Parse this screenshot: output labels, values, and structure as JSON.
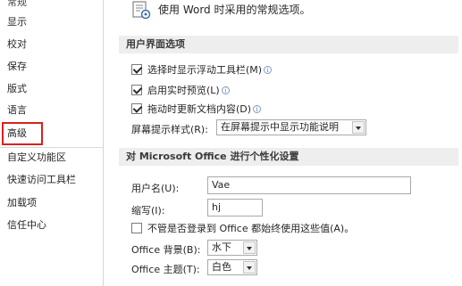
{
  "sidebar": {
    "items": [
      {
        "label": "常规"
      },
      {
        "label": "显示"
      },
      {
        "label": "校对"
      },
      {
        "label": "保存"
      },
      {
        "label": "版式"
      },
      {
        "label": "语言"
      },
      {
        "label": "高级"
      },
      {
        "label": "自定义功能区"
      },
      {
        "label": "快速访问工具栏"
      },
      {
        "label": "加载项"
      },
      {
        "label": "信任中心"
      }
    ],
    "highlighted": "高级",
    "highlight_color": "#d9221c"
  },
  "main": {
    "header_text": "使用 Word 时采用的常规选项。",
    "header_icon": "options-icon",
    "section_ui": {
      "title": "用户界面选项",
      "options": [
        {
          "label": "选择时显示浮动工具栏(M)",
          "checked": true
        },
        {
          "label": "启用实时预览(L)",
          "checked": true
        },
        {
          "label": "拖动时更新文档内容(D)",
          "checked": true
        }
      ],
      "tooltip_style_label": "屏幕提示样式(R):",
      "tooltip_style_value": "在屏幕提示中显示功能说明"
    },
    "section_personalize": {
      "title": "对 Microsoft Office 进行个性化设置",
      "username_label": "用户名(U):",
      "username_value": "Vae",
      "initials_label": "缩写(I):",
      "initials_value": "hj",
      "always_use_label": "不管是否登录到 Office 都始终使用这些值(A)。",
      "always_use_checked": false,
      "background_label": "Office 背景(B):",
      "background_value": "水下",
      "theme_label": "Office 主题(T):",
      "theme_value": "白色"
    },
    "info_glyph": "i",
    "section_bg": "#eeeeee"
  }
}
